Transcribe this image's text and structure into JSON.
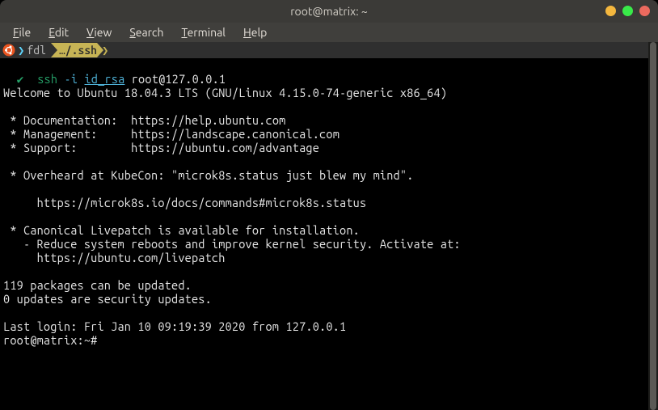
{
  "window": {
    "title": "root@matrix: ~"
  },
  "menubar": {
    "file": "File",
    "edit": "Edit",
    "view": "View",
    "search": "Search",
    "terminal": "Terminal",
    "help": "Help"
  },
  "prompt": {
    "arrow": "❯",
    "cmd": "fdl",
    "path": "…/.ssh",
    "tail": "❯"
  },
  "ssh_line": {
    "check": "✔",
    "cmd": "ssh",
    "flag": "-i",
    "keyfile": "id_rsa",
    "target": "root@127.0.0.1"
  },
  "motd": {
    "welcome": "Welcome to Ubuntu 18.04.3 LTS (GNU/Linux 4.15.0-74-generic x86_64)",
    "doc_label": " * Documentation:  ",
    "doc_url": "https://help.ubuntu.com",
    "mgmt_label": " * Management:     ",
    "mgmt_url": "https://landscape.canonical.com",
    "support_label": " * Support:        ",
    "support_url": "https://ubuntu.com/advantage",
    "kubecon": " * Overheard at KubeCon: \"microk8s.status just blew my mind\".",
    "microk8s_url_indent": "     ",
    "microk8s_url": "https://microk8s.io/docs/commands#microk8s.status",
    "livepatch_title": " * Canonical Livepatch is available for installation.",
    "livepatch_desc": "   - Reduce system reboots and improve kernel security. Activate at:",
    "livepatch_url_indent": "     ",
    "livepatch_url": "https://ubuntu.com/livepatch",
    "pkg_updates": "119 packages can be updated.",
    "sec_updates": "0 updates are security updates.",
    "last_login": "Last login: Fri Jan 10 09:19:39 2020 from 127.0.0.1",
    "shell_prompt": "root@matrix:~#"
  }
}
